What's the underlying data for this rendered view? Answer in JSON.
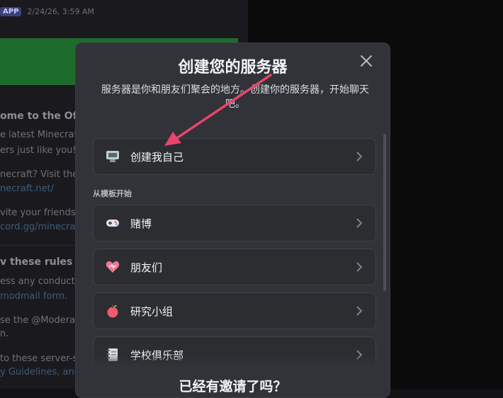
{
  "background": {
    "app_badge": "APP",
    "timestamp": "2/24/26, 3:59 AM",
    "lines": [
      {
        "text": "ome to the Offic",
        "bold": true
      },
      {
        "text": "e latest Minecraft"
      },
      {
        "text": "ers just like you!"
      },
      {
        "text": "necraft? Visit the o"
      },
      {
        "text": "necraft.net/",
        "link": true
      },
      {
        "text": "vite your friends? U"
      },
      {
        "text": "cord.gg/minecraft",
        "link": true
      },
      {
        "text": "v these rules for",
        "bold": true
      },
      {
        "text": "ess any conduct in"
      },
      {
        "text": "modmail form.",
        "link": true
      },
      {
        "text": "se the  @Moderato"
      },
      {
        "text": "n."
      },
      {
        "text": "to these server-s"
      },
      {
        "text": "y Guidelines, and",
        "link": true
      }
    ]
  },
  "modal": {
    "title": "创建您的服务器",
    "subtitle": "服务器是你和朋友们聚会的地方。创建你的服务器，开始聊天吧。",
    "create_own": {
      "label": "创建我自己",
      "icon": "custom-server-icon"
    },
    "section_label": "从模板开始",
    "templates": [
      {
        "label": "赌博",
        "icon": "gamepad-icon"
      },
      {
        "label": "朋友们",
        "icon": "heart-icon"
      },
      {
        "label": "研究小组",
        "icon": "apple-icon"
      },
      {
        "label": "学校俱乐部",
        "icon": "notebook-icon"
      }
    ],
    "footer_title": "已经有邀请了吗？"
  },
  "colors": {
    "modal_bg": "#313338",
    "option_bg": "#2b2d31",
    "annotation_arrow": "#e8456b"
  }
}
